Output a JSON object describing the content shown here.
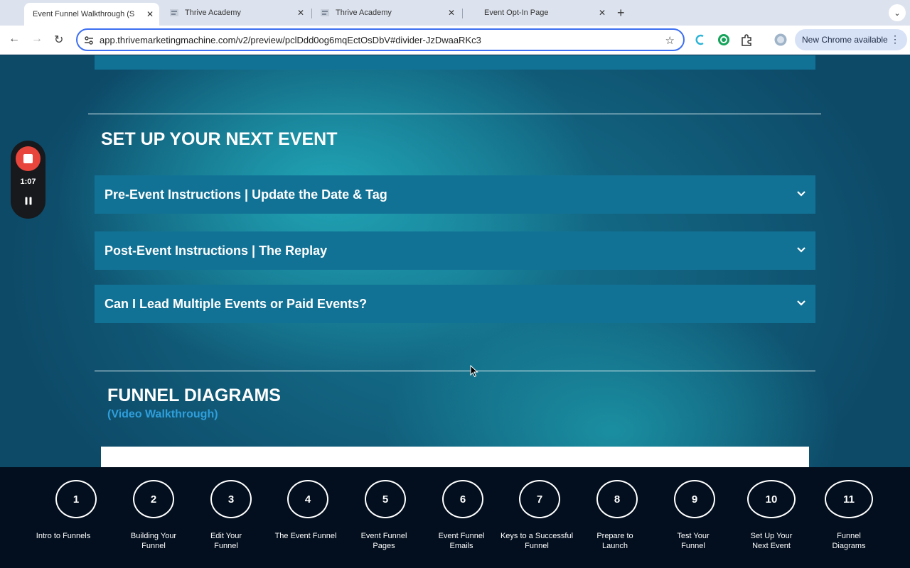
{
  "browser": {
    "tabs": [
      {
        "title": "Event Funnel Walkthrough (S",
        "active": true
      },
      {
        "title": "Thrive Academy",
        "active": false
      },
      {
        "title": "Thrive Academy",
        "active": false
      },
      {
        "title": "Event Opt-In Page",
        "active": false
      }
    ],
    "url": "app.thrivemarketingmachine.com/v2/preview/pclDdd0og6mqEctOsDbV#divider-JzDwaaRKc3",
    "update_label": "New Chrome available"
  },
  "recorder": {
    "time": "1:07"
  },
  "page": {
    "section_title": "SET UP YOUR NEXT EVENT",
    "accordions": [
      {
        "label": "Pre-Event Instructions | Update the Date & Tag"
      },
      {
        "label": "Post-Event Instructions | The Replay"
      },
      {
        "label": "Can I Lead Multiple Events or Paid Events?"
      }
    ],
    "diagrams_title": "FUNNEL DIAGRAMS",
    "diagrams_subtitle": "(Video Walkthrough)"
  },
  "steps": [
    {
      "number": "1",
      "label": "Intro to Funnels"
    },
    {
      "number": "2",
      "label": "Building Your Funnel"
    },
    {
      "number": "3",
      "label": "Edit Your Funnel"
    },
    {
      "number": "4",
      "label": "The Event Funnel"
    },
    {
      "number": "5",
      "label": "Event Funnel Pages"
    },
    {
      "number": "6",
      "label": "Event Funnel Emails"
    },
    {
      "number": "7",
      "label": "Keys to a Successful Funnel"
    },
    {
      "number": "8",
      "label": "Prepare to Launch"
    },
    {
      "number": "9",
      "label": "Test Your Funnel"
    },
    {
      "number": "10",
      "label": "Set Up Your Next Event"
    },
    {
      "number": "11",
      "label": "Funnel Diagrams"
    }
  ],
  "colors": {
    "accordion": "#127296",
    "subtitle": "#2f9fdc",
    "record": "#e8463c",
    "stepbar": "#030f1e"
  }
}
